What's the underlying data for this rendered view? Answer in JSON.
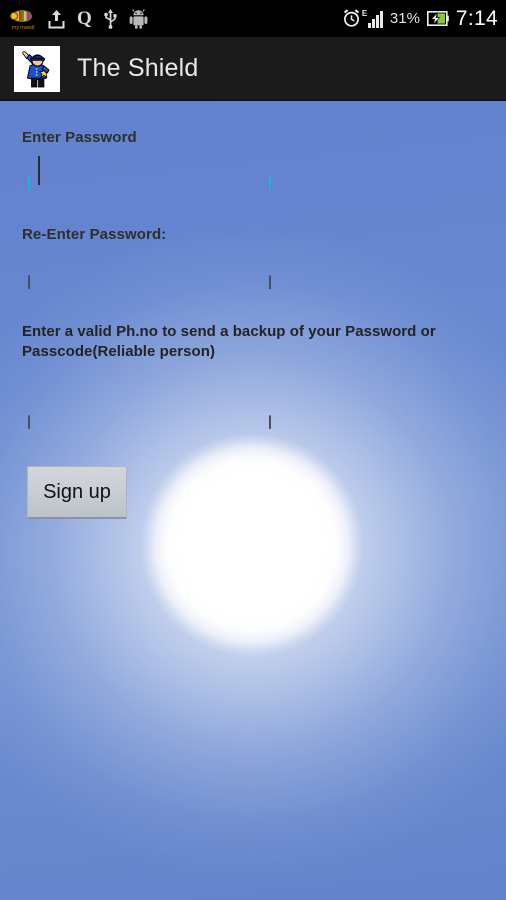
{
  "status_bar": {
    "icons": [
      {
        "name": "app-notification-bee-icon",
        "label": "my mandi"
      },
      {
        "name": "download-install-icon"
      },
      {
        "name": "quickoffice-q-icon",
        "label": "Q"
      },
      {
        "name": "usb-icon"
      },
      {
        "name": "android-robot-icon"
      }
    ],
    "alarm_icon": "alarm-clock-icon",
    "network_type": "E",
    "signal_icon": "signal-bars-icon",
    "battery_percent": "31%",
    "battery_icon": "battery-charging-icon",
    "time": "7:14"
  },
  "action_bar": {
    "app_icon": "police-officer-icon",
    "title": "The Shield"
  },
  "form": {
    "password_label": "Enter Password",
    "password_value": "",
    "password_placeholder": "",
    "reenter_label": "Re-Enter Password:",
    "reenter_value": "",
    "reenter_placeholder": "",
    "phone_hint": "Enter a valid Ph.no to send a backup of your Password or Passcode(Reliable person)",
    "phone_value": "",
    "phone_placeholder": "",
    "signup_label": "Sign up"
  },
  "colors": {
    "status_bar_bg": "#000000",
    "action_bar_bg": "#1b1b1b",
    "accent_focus": "#17b6e0",
    "sky_blue": "#4c71c7",
    "button_bg": "#c9ced5",
    "battery_green": "#8ec63f"
  }
}
